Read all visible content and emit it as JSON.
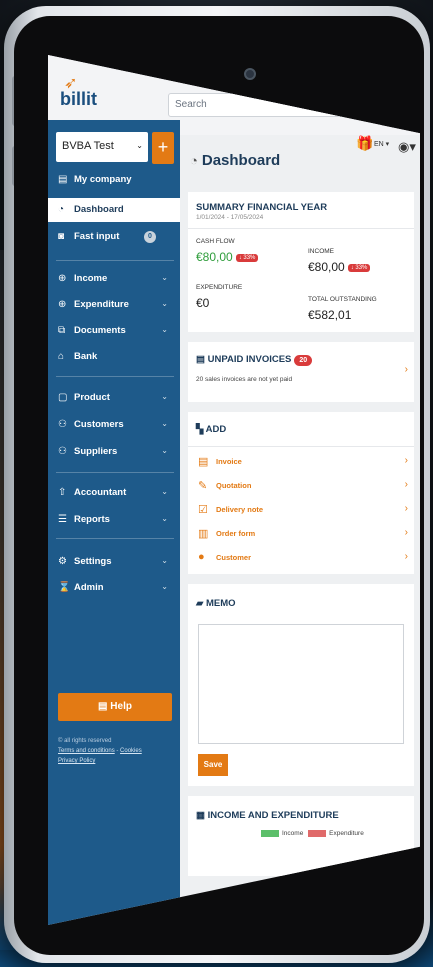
{
  "brand": {
    "logo": "billit"
  },
  "header": {
    "search_placeholder": "Search",
    "language": "EN"
  },
  "sidebar": {
    "company": "BVBA Test",
    "items": [
      {
        "label": "My company",
        "icon": "building-icon"
      },
      {
        "label": "Dashboard",
        "icon": "dashboard-icon"
      },
      {
        "label": "Fast input",
        "icon": "camera-icon",
        "badge": "0"
      },
      {
        "label": "Income",
        "icon": "arrow-down-circle-icon"
      },
      {
        "label": "Expenditure",
        "icon": "arrow-up-circle-icon"
      },
      {
        "label": "Documents",
        "icon": "documents-icon"
      },
      {
        "label": "Bank",
        "icon": "bank-icon"
      },
      {
        "label": "Product",
        "icon": "product-icon"
      },
      {
        "label": "Customers",
        "icon": "customers-icon"
      },
      {
        "label": "Suppliers",
        "icon": "suppliers-icon"
      },
      {
        "label": "Accountant",
        "icon": "accountant-icon"
      },
      {
        "label": "Reports",
        "icon": "reports-icon"
      },
      {
        "label": "Settings",
        "icon": "settings-icon"
      },
      {
        "label": "Admin",
        "icon": "admin-icon"
      }
    ],
    "help": "Help",
    "footer": {
      "rights": "© all rights reserved",
      "terms": "Terms and conditions",
      "sep": " - ",
      "cookies": "Cookies",
      "privacy": "Privacy Policy"
    }
  },
  "dashboard": {
    "title": "Dashboard",
    "summary": {
      "title": "SUMMARY FINANCIAL YEAR",
      "period": "1/01/2024 - 17/05/2024",
      "cash_flow_label": "CASH FLOW",
      "cash_flow_value": "€80,00",
      "cash_flow_pct": "↓ 33%",
      "income_label": "INCOME",
      "income_value": "€80,00",
      "income_pct": "↓ 33%",
      "expenditure_label": "EXPENDITURE",
      "expenditure_value": "€0",
      "outstanding_label": "TOTAL OUTSTANDING",
      "outstanding_value": "€582,01"
    },
    "unpaid": {
      "title": "UNPAID INVOICES",
      "count": "20",
      "note": "20 sales invoices are not yet paid"
    },
    "add": {
      "title": "ADD",
      "items": [
        "Invoice",
        "Quotation",
        "Delivery note",
        "Order form",
        "Customer"
      ]
    },
    "memo": {
      "title": "MEMO",
      "save": "Save"
    },
    "income_expenditure": {
      "title": "INCOME AND EXPENDITURE",
      "legend_income": "Income",
      "legend_expenditure": "Expenditure"
    }
  },
  "colors": {
    "sidebar": "#1e5a8a",
    "accent": "#e37a14",
    "positive": "#2f9d3c",
    "negative": "#d93b3b"
  }
}
